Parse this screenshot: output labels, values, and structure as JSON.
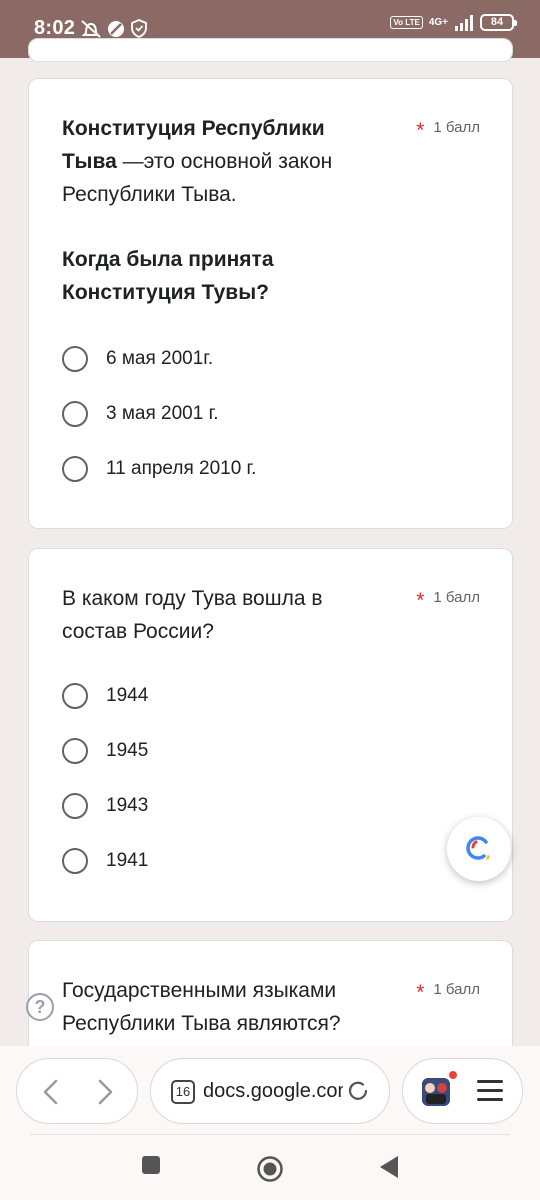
{
  "status_bar": {
    "time": "8:02",
    "network": "4G+",
    "volte": "Vo LTE",
    "battery": "84"
  },
  "questions": [
    {
      "title_bold": "Конституция Республики Тыва",
      "title_rest": " —это  основной закон Республики Тыва.",
      "subtitle": "Когда была принята Конституция Тувы?",
      "required_mark": "*",
      "points": "1 балл",
      "options": [
        "6 мая 2001г.",
        "3 мая 2001 г.",
        "11 апреля 2010 г."
      ]
    },
    {
      "title": "В каком году Тува вошла в состав России?",
      "required_mark": "*",
      "points": "1 балл",
      "options": [
        "1944",
        "1945",
        "1943",
        "1941"
      ]
    },
    {
      "title": "Государственными языками Республики Тыва являются?",
      "required_mark": "*",
      "points": "1 балл"
    }
  ],
  "browser": {
    "tab_count": "16",
    "url": "docs.google.com",
    "help_icon_text": "?"
  },
  "colors": {
    "status_bar": "#8b6a66",
    "page_background": "#f1ecea",
    "required_star": "#d93025"
  },
  "icons": [
    "mute-icon",
    "data-saver-icon",
    "shield-icon",
    "signal-icon",
    "lens-icon",
    "back-icon",
    "forward-icon",
    "reload-icon",
    "avatar-icon",
    "menu-icon",
    "square-icon",
    "home-icon",
    "back-triangle-icon"
  ]
}
